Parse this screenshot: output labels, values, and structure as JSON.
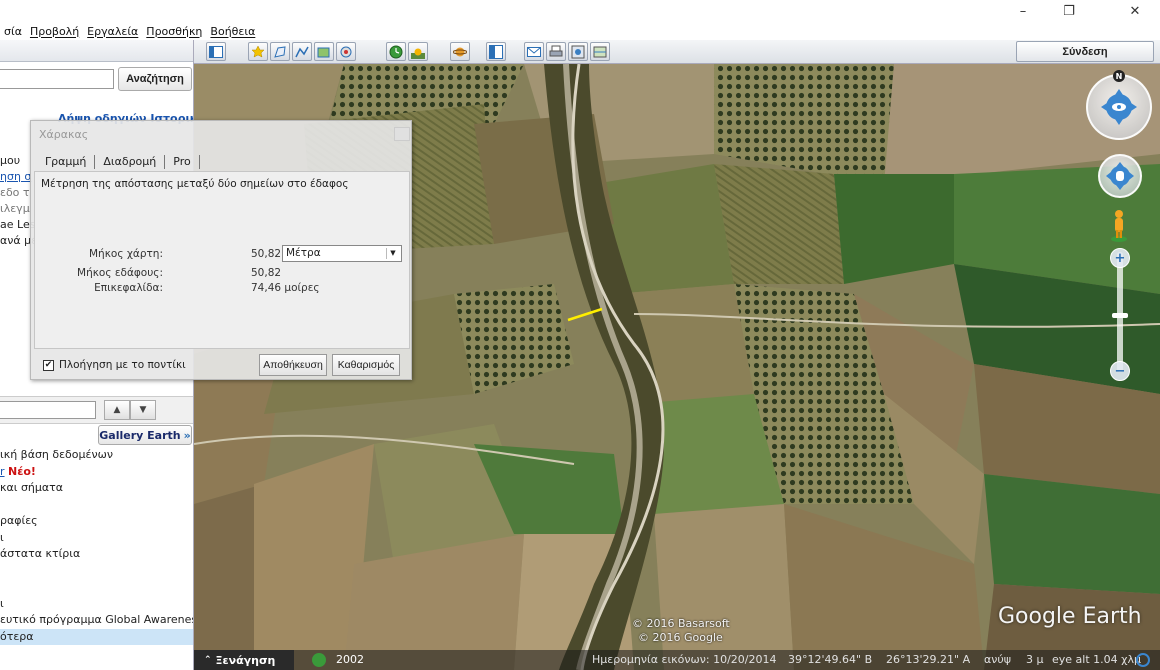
{
  "window": {
    "minimize": "–",
    "restore": "❐",
    "close": "✕"
  },
  "menu": {
    "items": [
      "σία",
      "Προβολή",
      "Εργαλεία",
      "Προσθήκη",
      "Βοήθεια"
    ]
  },
  "search": {
    "button": "Αναζήτηση",
    "route_links": "Λήψη οδηγιών   Ιστορικό"
  },
  "side_fragments": {
    "f1": "μου",
    "f2": "ηση σ",
    "f3": "εδο τ",
    "f4": "ιλεγμ",
    "f5": "ae Les",
    "f6": "ανά μέ"
  },
  "places": {
    "up": "▲",
    "down": "▼"
  },
  "gallery": {
    "label": "Gallery Earth",
    "arrow": "»"
  },
  "layers": {
    "items": [
      {
        "text": "ική βάση δεδομένων",
        "extra": ""
      },
      {
        "text": "r",
        "extra": "Νέο!"
      },
      {
        "text": "και σήματα",
        "extra": ""
      },
      {
        "text": "",
        "extra": ""
      },
      {
        "text": "ραφίες",
        "extra": ""
      },
      {
        "text": "ι",
        "extra": ""
      },
      {
        "text": "άστατα κτίρια",
        "extra": ""
      },
      {
        "text": "",
        "extra": ""
      },
      {
        "text": "",
        "extra": ""
      },
      {
        "text": "ι",
        "extra": ""
      },
      {
        "text": "ευτικό πρόγραμμα Global Awareness",
        "extra": ""
      },
      {
        "text": "ότερα",
        "extra": ""
      }
    ]
  },
  "toolbar": {
    "signin": "Σύνδεση"
  },
  "ruler": {
    "title": "Χάρακας",
    "tabs": [
      "Γραμμή",
      "Διαδρομή",
      "Pro"
    ],
    "description": "Μέτρηση της απόστασης μεταξύ δύο σημείων στο έδαφος",
    "map_length_label": "Μήκος χάρτη:",
    "map_length_value": "50,82",
    "unit": "Μέτρα",
    "ground_length_label": "Μήκος εδάφους:",
    "ground_length_value": "50,82",
    "heading_label": "Επικεφαλίδα:",
    "heading_value": "74,46 μοίρες",
    "mouse_nav_label": "Πλοήγηση με το ποντίκι",
    "mouse_nav_checked": "✔",
    "save_button": "Αποθήκευση",
    "clear_button": "Καθαρισμός"
  },
  "navigation": {
    "north": "N",
    "zoom_in": "+",
    "zoom_out": "−"
  },
  "map": {
    "copyright_1": "© 2016 Basarsoft",
    "copyright_2": "© 2016 Google",
    "logo": "Google Earth"
  },
  "status": {
    "tour_label": "Ξενάγηση",
    "year": "2002",
    "imagery_date": "Ημερομηνία εικόνων: 10/20/2014",
    "lat": "39°12'49.64\" Β",
    "lon": "26°13'29.21\" Α",
    "elev_label": "ανύψ",
    "elev_value": "3 μ",
    "eye_alt": "eye alt  1.04 χλμ"
  }
}
